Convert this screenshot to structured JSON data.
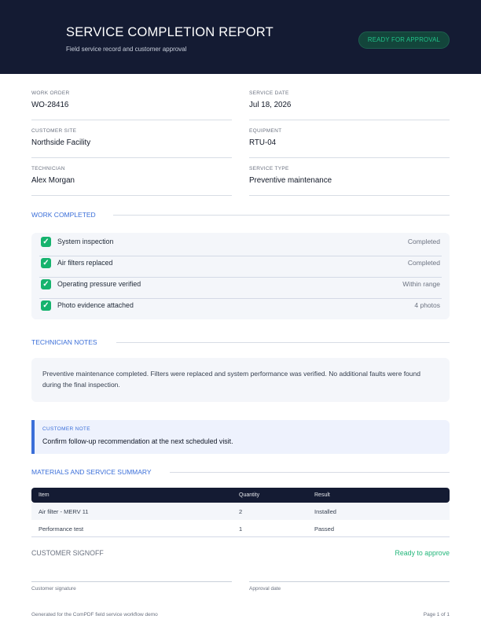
{
  "header": {
    "title": "SERVICE COMPLETION REPORT",
    "subtitle": "Field service record and customer approval",
    "status_badge": "READY FOR APPROVAL"
  },
  "fields": {
    "work_order": {
      "label": "WORK ORDER",
      "value": "WO-28416"
    },
    "service_date": {
      "label": "SERVICE DATE",
      "value": "Jul 18, 2026"
    },
    "customer_site": {
      "label": "CUSTOMER SITE",
      "value": "Northside Facility"
    },
    "equipment": {
      "label": "EQUIPMENT",
      "value": "RTU-04"
    },
    "technician": {
      "label": "TECHNICIAN",
      "value": "Alex Morgan"
    },
    "service_type": {
      "label": "SERVICE TYPE",
      "value": "Preventive maintenance"
    }
  },
  "work_completed": {
    "title": "WORK COMPLETED",
    "items": [
      {
        "icon": "checkbox-checked-icon",
        "label": "System inspection",
        "status": "Completed"
      },
      {
        "icon": "checkbox-checked-icon",
        "label": "Air filters replaced",
        "status": "Completed"
      },
      {
        "icon": "checkbox-checked-icon",
        "label": "Operating pressure verified",
        "status": "Within range"
      },
      {
        "icon": "checkbox-checked-icon",
        "label": "Photo evidence attached",
        "status": "4 photos"
      }
    ]
  },
  "technician_notes": {
    "title": "TECHNICIAN NOTES",
    "text": "Preventive maintenance completed. Filters were replaced and system performance was verified. No additional faults were found during the final inspection."
  },
  "customer_note": {
    "label": "CUSTOMER NOTE",
    "text": "Confirm follow-up recommendation at the next scheduled visit."
  },
  "materials": {
    "title": "MATERIALS AND SERVICE SUMMARY",
    "columns": [
      "Item",
      "Quantity",
      "Result"
    ],
    "rows": [
      [
        "Air filter - MERV 11",
        "2",
        "Installed"
      ],
      [
        "Performance test",
        "1",
        "Passed"
      ]
    ]
  },
  "signoff": {
    "title": "CUSTOMER SIGNOFF",
    "status": "Ready to approve",
    "signature_label": "Customer signature",
    "date_label": "Approval date"
  },
  "footer": {
    "left": "Generated for the ComPDF field service workflow demo",
    "right": "Page 1 of 1"
  },
  "colors": {
    "header_bg": "#141b33",
    "accent_blue": "#3b6fd9",
    "success_green": "#22b67a"
  }
}
